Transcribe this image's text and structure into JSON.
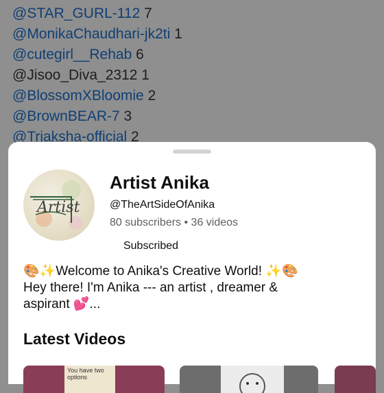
{
  "comments": [
    {
      "handle": "@STAR_GURL-112",
      "count": "7",
      "linked": true
    },
    {
      "handle": "@MonikaChaudhari-jk2ti",
      "count": "1",
      "linked": true
    },
    {
      "handle": "@cutegirl__Rehab",
      "count": "6",
      "linked": true
    },
    {
      "handle": "@Jisoo_Diva_2312",
      "count": "1",
      "linked": false
    },
    {
      "handle": "@BlossomXBloomie",
      "count": "2",
      "linked": true
    },
    {
      "handle": "@BrownBEAR-7",
      "count": "3",
      "linked": true
    },
    {
      "handle": "@Triaksha-official",
      "count": "2",
      "linked": true
    }
  ],
  "channel": {
    "name": "Artist Anika",
    "handle": "@TheArtSideOfAnika",
    "stats": "80 subscribers • 36 videos",
    "subscribe_label": "Subscribed",
    "description_lines": [
      "🎨✨Welcome to Anika's Creative World! ✨🎨",
      "Hey there!  I'm Anika --- an artist , dreamer &",
      " aspirant 💕..."
    ],
    "avatar_text": "Artist"
  },
  "latest_videos": {
    "heading": "Latest Videos",
    "thumb_text": "You have two options"
  },
  "colors": {
    "link": "#0f3f74",
    "scrim": "#8f8f8f",
    "sheet": "#ffffff"
  }
}
